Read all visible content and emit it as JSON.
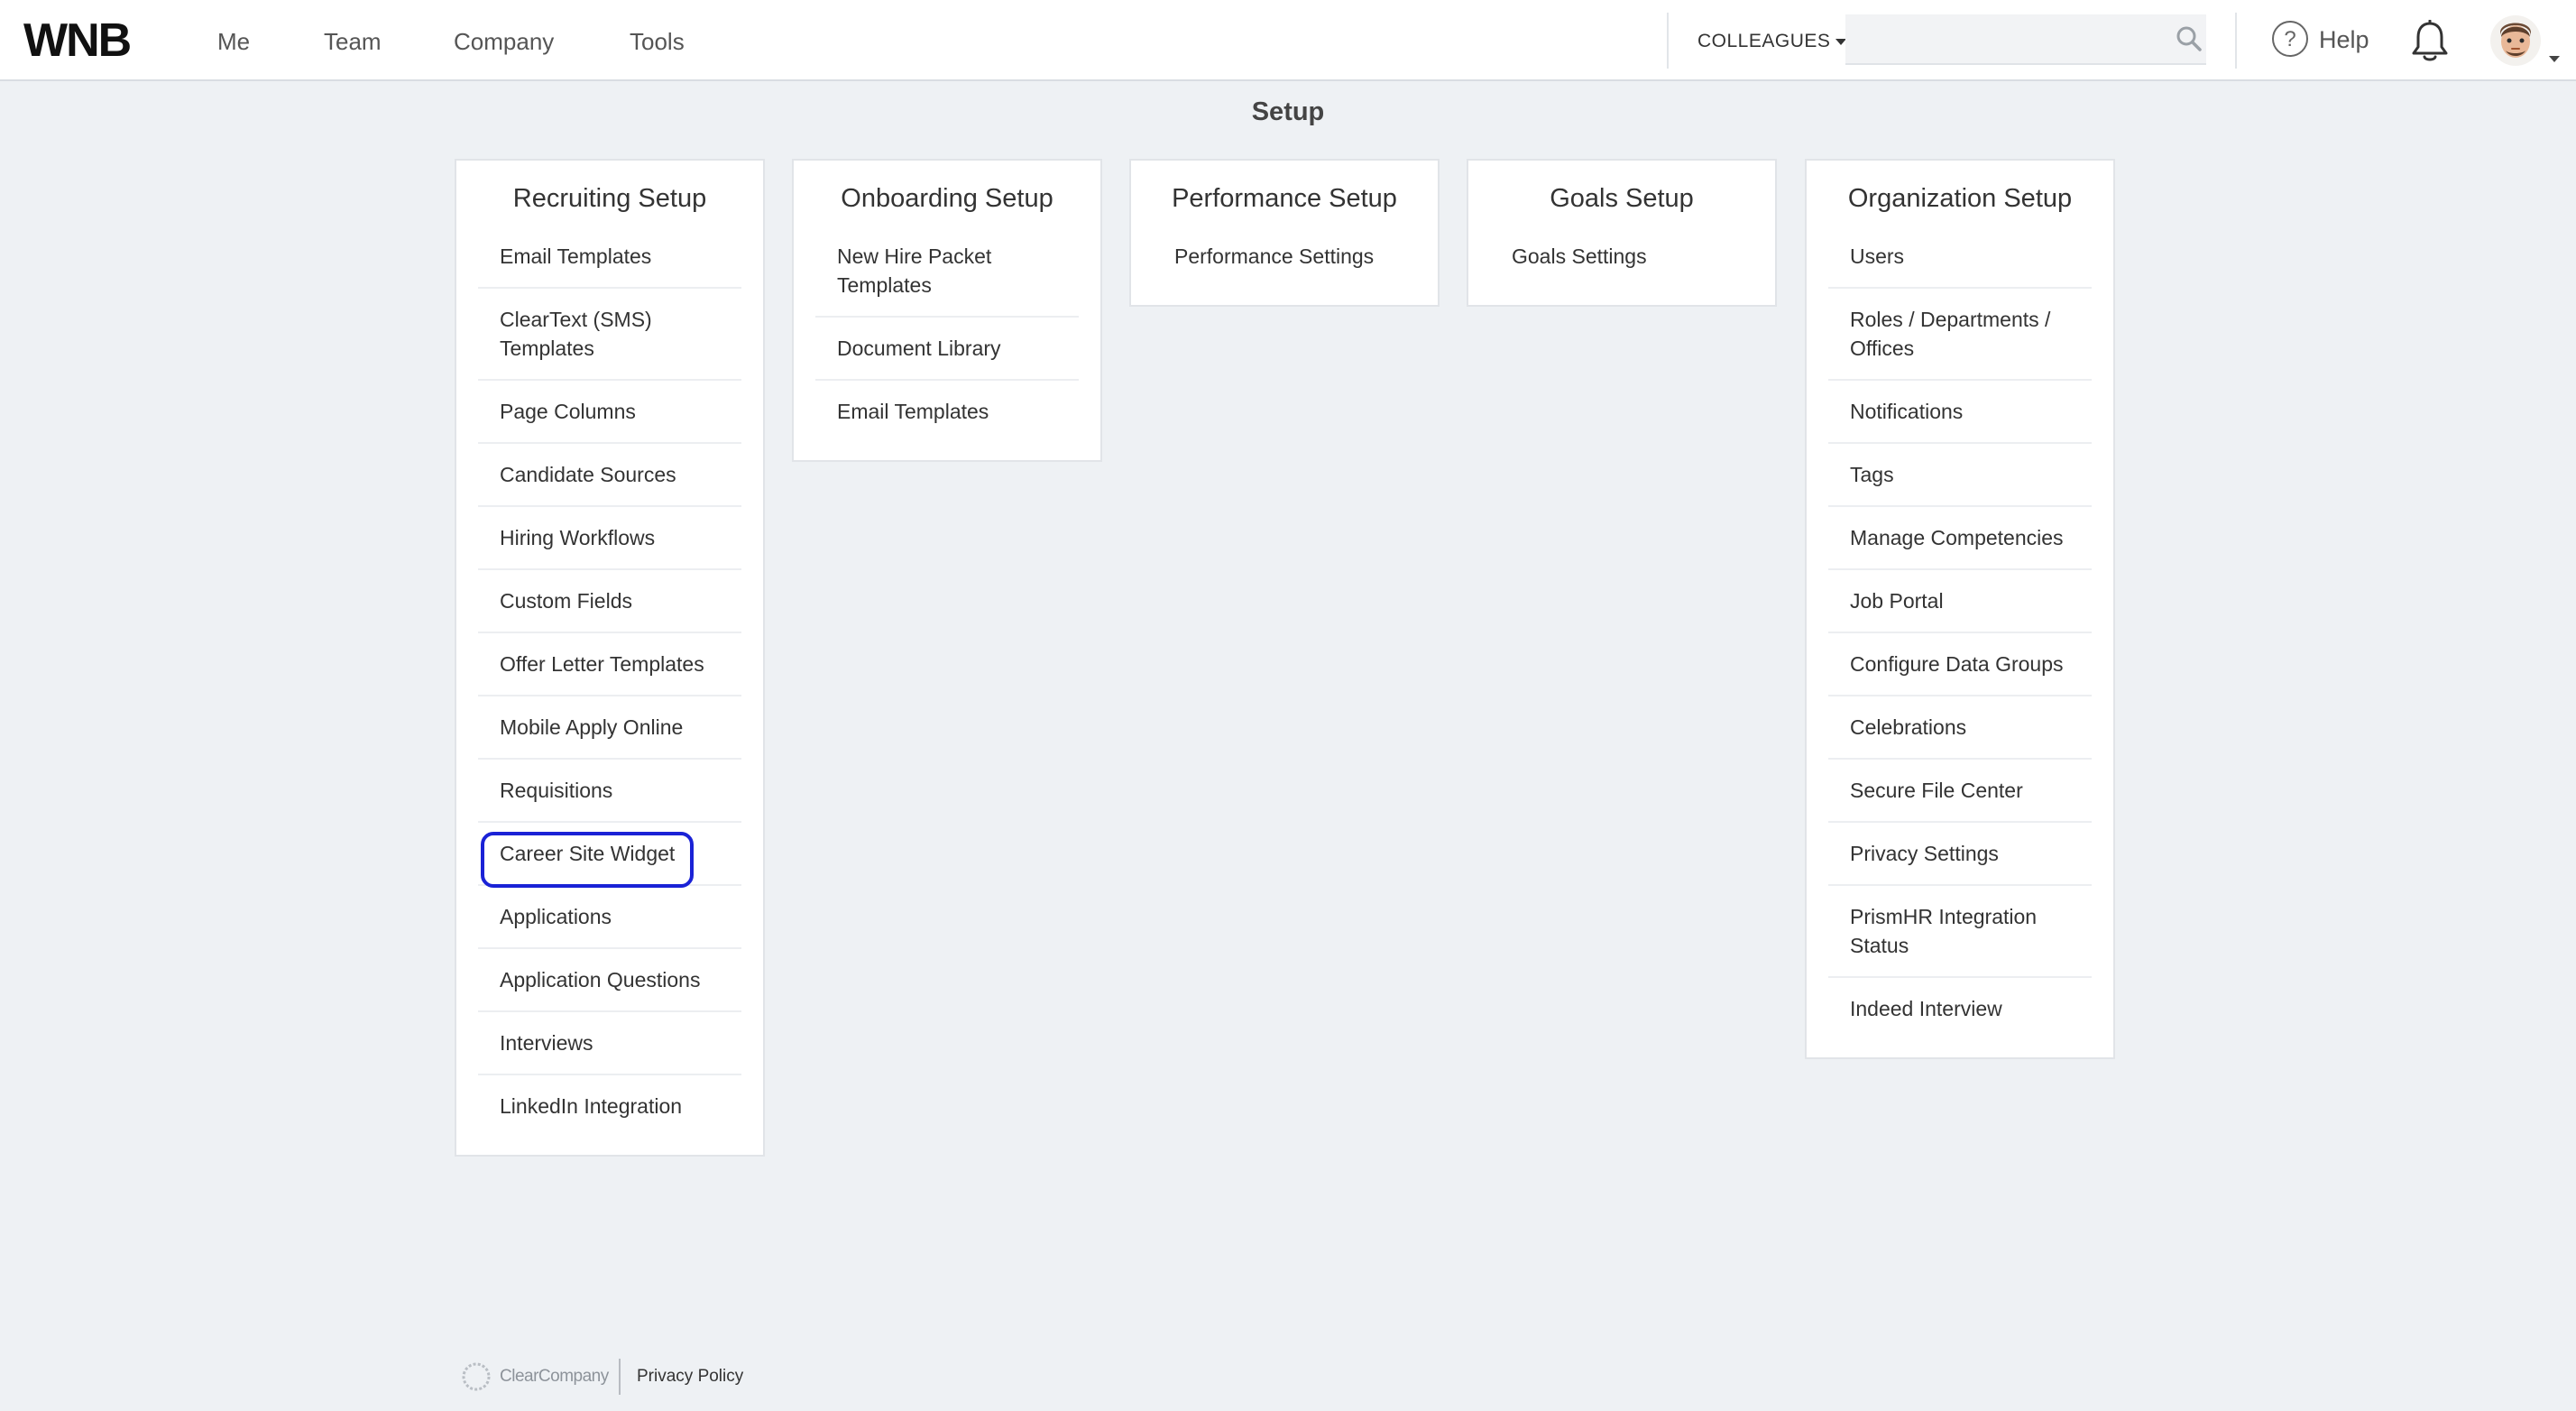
{
  "header": {
    "logo": "WNB",
    "nav": [
      "Me",
      "Team",
      "Company",
      "Tools"
    ],
    "search_scope": "COLLEAGUES",
    "search_value": "",
    "search_placeholder": "",
    "help_label": "Help"
  },
  "page": {
    "title": "Setup"
  },
  "cards": [
    {
      "title": "Recruiting Setup",
      "items": [
        "Email Templates",
        "ClearText (SMS) Templates",
        "Page Columns",
        "Candidate Sources",
        "Hiring Workflows",
        "Custom Fields",
        "Offer Letter Templates",
        "Mobile Apply Online",
        "Requisitions",
        "Career Site Widget",
        "Applications",
        "Application Questions",
        "Interviews",
        "LinkedIn Integration"
      ],
      "highlighted_item": "Career Site Widget"
    },
    {
      "title": "Onboarding Setup",
      "items": [
        "New Hire Packet Templates",
        "Document Library",
        "Email Templates"
      ]
    },
    {
      "title": "Performance Setup",
      "items": [
        "Performance Settings"
      ]
    },
    {
      "title": "Goals Setup",
      "items": [
        "Goals Settings"
      ]
    },
    {
      "title": "Organization Setup",
      "items": [
        "Users",
        "Roles / Departments / Offices",
        "Notifications",
        "Tags",
        "Manage Competencies",
        "Job Portal",
        "Configure Data Groups",
        "Celebrations",
        "Secure File Center",
        "Privacy Settings",
        "PrismHR Integration Status",
        "Indeed Interview"
      ]
    }
  ],
  "footer": {
    "brand": "ClearCompany",
    "privacy_link": "Privacy Policy"
  },
  "colors": {
    "highlight": "#1a22d6",
    "background": "#eef1f4"
  }
}
